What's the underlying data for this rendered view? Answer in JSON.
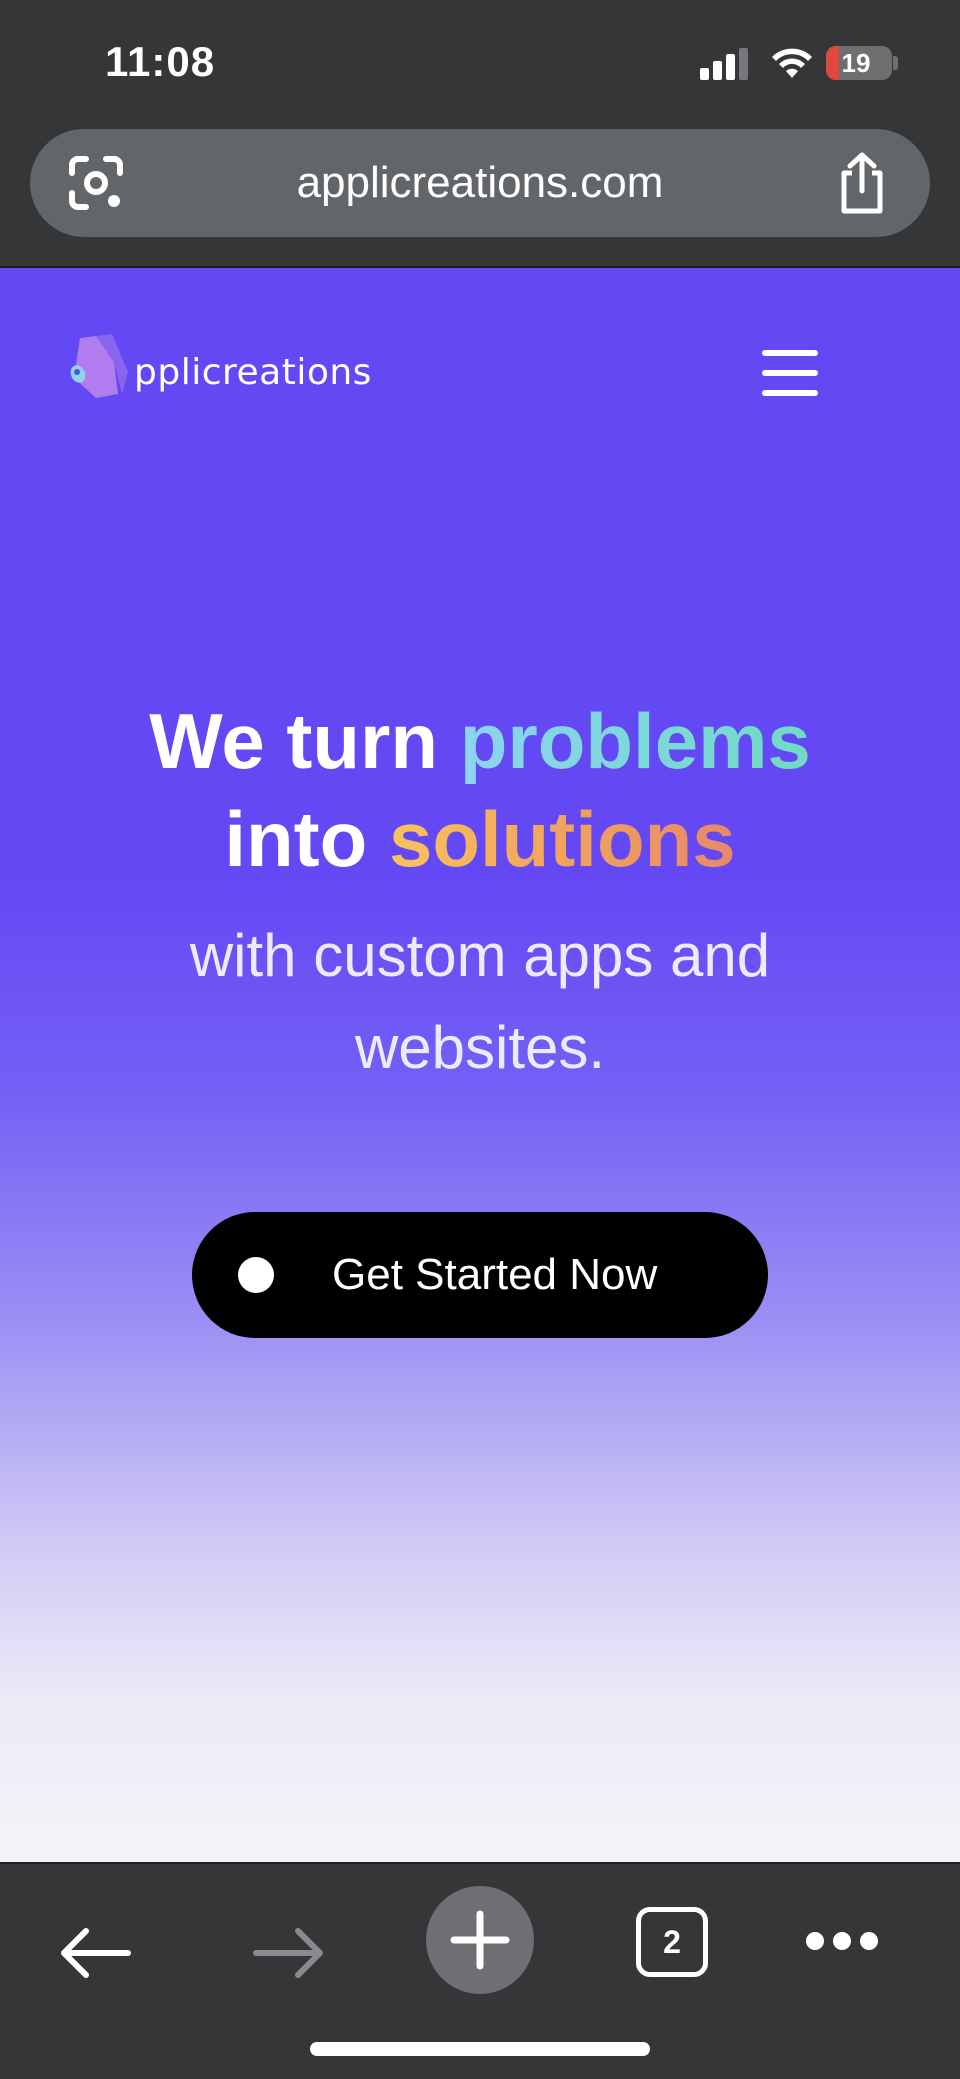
{
  "status_bar": {
    "time": "11:08",
    "battery_level": "19",
    "battery_fraction": 0.19,
    "battery_color": "#e0473d",
    "signal_bars_active": 3,
    "signal_bars_total": 4,
    "icons": [
      "signal-icon",
      "wifi-icon",
      "battery-charging-icon"
    ]
  },
  "url_bar": {
    "url": "applicreations.com",
    "left_icon": "google-lens-icon",
    "right_icon": "share-icon"
  },
  "site": {
    "logo_text": "pplicreations",
    "logo_icon": "applicreations-logo-mark",
    "menu_icon": "hamburger-menu-icon",
    "headline": {
      "line1_white": "We turn",
      "line1_accent": "problems",
      "line2_white": "into",
      "line2_accent": "solutions"
    },
    "subheadline_line1": "with custom apps and",
    "subheadline_line2": "websites.",
    "cta_label": "Get Started Now",
    "colors": {
      "background": "#6448f4",
      "accent_teal": "#7fd8dc",
      "accent_orange": "#f0a35d",
      "cta_background": "#000000"
    }
  },
  "toolbar": {
    "back_icon": "back-arrow-icon",
    "forward_icon": "forward-arrow-icon",
    "new_tab_icon": "plus-icon",
    "tab_count": "2",
    "more_icon": "more-dots-icon"
  }
}
